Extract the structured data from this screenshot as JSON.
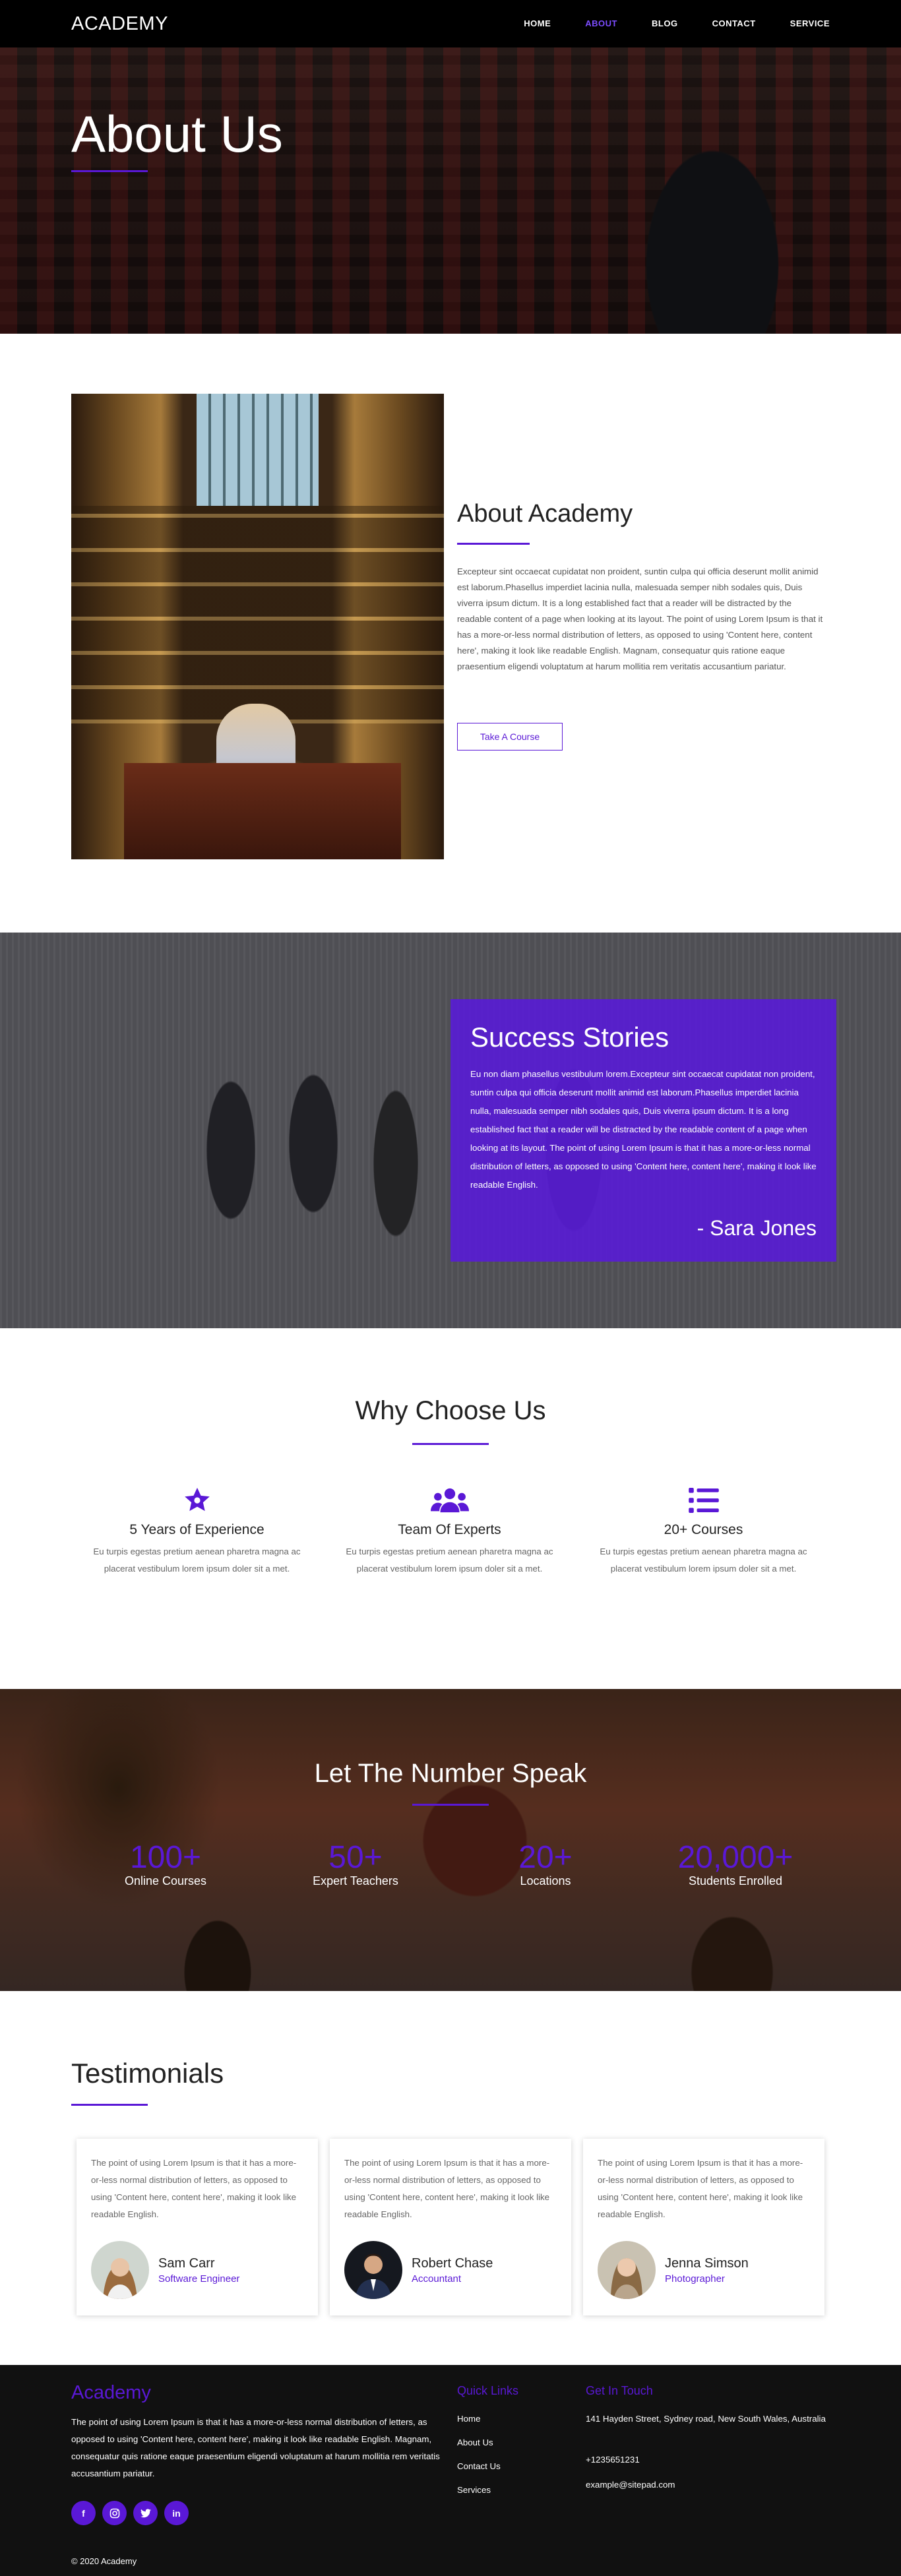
{
  "nav": {
    "logo": "ACADEMY",
    "items": [
      {
        "label": "HOME",
        "active": false
      },
      {
        "label": "ABOUT",
        "active": true
      },
      {
        "label": "BLOG",
        "active": false
      },
      {
        "label": "CONTACT",
        "active": false
      },
      {
        "label": "SERVICE",
        "active": false
      }
    ]
  },
  "hero": {
    "title": "About Us"
  },
  "about": {
    "heading": "About Academy",
    "text": "Excepteur sint occaecat cupidatat non proident, suntin culpa qui officia deserunt mollit animid est laborum.Phasellus imperdiet lacinia nulla, malesuada semper nibh sodales quis, Duis viverra ipsum dictum. It is a long established fact that a reader will be distracted by the readable content of a page when looking at its layout. The point of using Lorem Ipsum is that it has a more-or-less normal distribution of letters, as opposed to using 'Content here, content here', making it look like readable English. Magnam, consequatur quis ratione eaque praesentium eligendi voluptatum at harum mollitia rem veritatis accusantium pariatur.",
    "button": "Take A Course"
  },
  "success": {
    "heading": "Success Stories",
    "text": "Eu non diam phasellus vestibulum lorem.Excepteur sint occaecat cupidatat non proident, suntin culpa qui officia deserunt mollit animid est laborum.Phasellus imperdiet lacinia nulla, malesuada semper nibh sodales quis, Duis viverra ipsum dictum. It is a long established fact that a reader will be distracted by the readable content of a page when looking at its layout. The point of using Lorem Ipsum is that it has a more-or-less normal distribution of letters, as opposed to using 'Content here, content here', making it look like readable English.",
    "author": "- Sara Jones"
  },
  "why": {
    "heading": "Why Choose Us",
    "features": [
      {
        "icon": "star-icon",
        "title": "5 Years of Experience",
        "text": "Eu turpis egestas pretium aenean pharetra magna ac placerat vestibulum lorem ipsum doler sit a met."
      },
      {
        "icon": "users-icon",
        "title": "Team Of Experts",
        "text": "Eu turpis egestas pretium aenean pharetra magna ac placerat vestibulum lorem ipsum doler sit a met."
      },
      {
        "icon": "list-icon",
        "title": "20+ Courses",
        "text": "Eu turpis egestas pretium aenean pharetra magna ac placerat vestibulum lorem ipsum doler sit a met."
      }
    ]
  },
  "numbers": {
    "heading": "Let The Number Speak",
    "stats": [
      {
        "value": "100+",
        "label": "Online Courses"
      },
      {
        "value": "50+",
        "label": "Expert Teachers"
      },
      {
        "value": "20+",
        "label": "Locations"
      },
      {
        "value": "20,000+",
        "label": "Students Enrolled"
      }
    ]
  },
  "testimonials": {
    "heading": "Testimonials",
    "items": [
      {
        "text": "The point of using Lorem Ipsum is that it has a more-or-less normal distribution of letters, as opposed to using 'Content here, content here', making it look like readable English.",
        "name": "Sam Carr",
        "role": "Software Engineer"
      },
      {
        "text": "The point of using Lorem Ipsum is that it has a more-or-less normal distribution of letters, as opposed to using 'Content here, content here', making it look like readable English.",
        "name": "Robert Chase",
        "role": "Accountant"
      },
      {
        "text": "The point of using Lorem Ipsum is that it has a more-or-less normal distribution of letters, as opposed to using 'Content here, content here', making it look like readable English.",
        "name": "Jenna Simson",
        "role": "Photographer"
      }
    ]
  },
  "footer": {
    "logo": "Academy",
    "text": "The point of using Lorem Ipsum is that it has a more-or-less normal distribution of letters, as opposed to using 'Content here, content here', making it look like readable English. Magnam, consequatur quis ratione eaque praesentium eligendi voluptatum at harum mollitia rem veritatis accusantium pariatur.",
    "socials": [
      "f",
      "ig",
      "tw",
      "in"
    ],
    "quick_links_heading": "Quick Links",
    "quick_links": [
      "Home",
      "About Us",
      "Contact Us",
      "Services"
    ],
    "contact_heading": "Get In Touch",
    "address": "141 Hayden Street, Sydney road, New South Wales, Australia",
    "phone": "+1235651231",
    "email": "example@sitepad.com",
    "copyright": "© 2020 Academy"
  },
  "colors": {
    "accent": "#5a18d6",
    "nav_active": "#7c4dff",
    "footer_bg": "#111111"
  }
}
